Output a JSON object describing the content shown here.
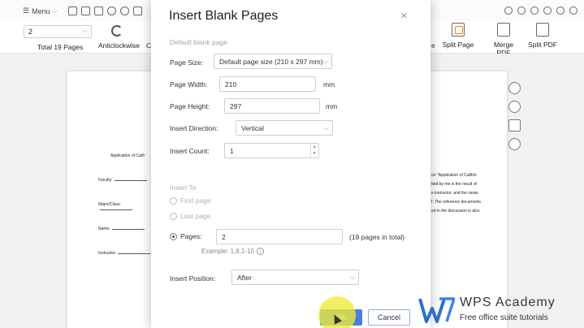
{
  "toolbar": {
    "menu_label": "Menu"
  },
  "ribbon": {
    "page_select_value": "2",
    "total_pages": "Total 19 Pages",
    "rotate_label": "Anticlockwise",
    "tools": [
      {
        "label": "Split Page"
      },
      {
        "label": "Merge PDF"
      },
      {
        "label": "Split PDF"
      }
    ],
    "partial_left_letter": "C",
    "partial_right_letter": "e"
  },
  "document": {
    "left_page": {
      "heading": "Application of Catfi",
      "fields": [
        "Faculty:",
        "Major/Class:",
        "Name:",
        "Instructor:"
      ]
    },
    "right_page": {
      "lines": [
        "on \"Application of Catfish",
        "tted by me is the result of",
        "e instructor, and the views",
        "f. The reference documents",
        "ed in the discussion is also"
      ]
    }
  },
  "dialog": {
    "title": "Insert Blank Pages",
    "close_glyph": "×",
    "section_default": "Default blank page",
    "page_size": {
      "label": "Page Size:",
      "value": "Default page size (210 x 297 mm)"
    },
    "page_width": {
      "label": "Page Width:",
      "value": "210",
      "unit": "mm"
    },
    "page_height": {
      "label": "Page Height:",
      "value": "297",
      "unit": "mm"
    },
    "insert_direction": {
      "label": "Insert Direction:",
      "value": "Vertical"
    },
    "insert_count": {
      "label": "Insert Count:",
      "value": "1"
    },
    "insert_to": {
      "label": "Insert To",
      "first_page": "First page",
      "last_page": "Last page",
      "pages_label": "Pages:",
      "pages_value": "2",
      "pages_total": "(19 pages in total)",
      "example": "Example: 1,8,1-10"
    },
    "insert_position": {
      "label": "Insert Position:",
      "value": "After"
    },
    "ok_label": "OK",
    "cancel_label": "Cancel"
  },
  "watermark": {
    "title": "WPS Academy",
    "subtitle": "Free office suite tutorials"
  },
  "colors": {
    "ok_button": "#4a7fd8",
    "highlight": "#eeec36",
    "accent_orange": "#f07d1a"
  }
}
